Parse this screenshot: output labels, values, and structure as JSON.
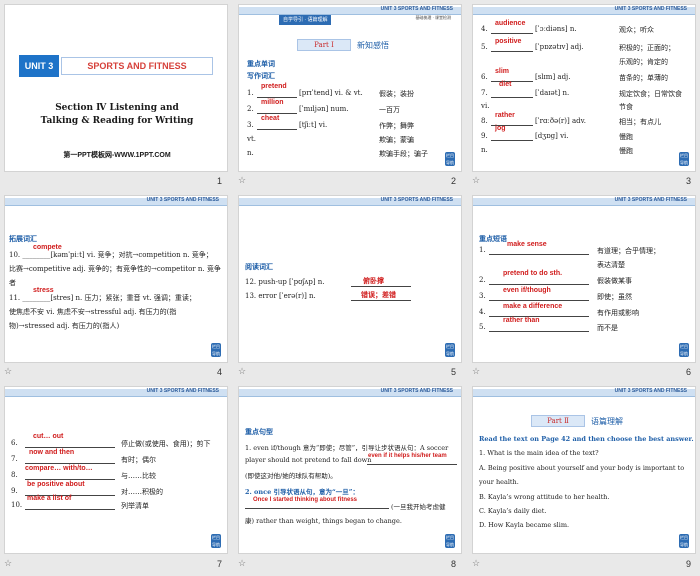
{
  "header": "UNIT 3   SPORTS AND FITNESS",
  "pager_label": "栏目导航",
  "star": "☆",
  "slide1": {
    "unit": "UNIT 3",
    "title": "SPORTS AND FITNESS",
    "section_line1": "Section Ⅳ  Listening and",
    "section_line2": "Talking & Reading for Writing",
    "site": "第一PPT模板网-WWW.1PPT.COM",
    "num": "1"
  },
  "slide2": {
    "tag": "自学导引 · 语篇理解",
    "tag_small": "基础梳理 · 课堂检测",
    "part": "Part Ⅰ",
    "part_title": "新知感悟",
    "h1": "重点单词",
    "h2": "写作词汇",
    "rows": [
      {
        "no": "1.",
        "ans": "pretend",
        "phon": "[prɪˈtend] vi. & vt.",
        "cn": "假装；装扮"
      },
      {
        "no": "2.",
        "ans": "million",
        "phon": "[ˈmɪljən] num.",
        "cn": "一百万"
      },
      {
        "no": "3.",
        "ans": "cheat",
        "phon": "[tʃiːt] vi.",
        "cn": "作弊；舞弊"
      },
      {
        "no": "",
        "ans": "",
        "phon": "vt.",
        "cn": "欺骗；蒙骗"
      },
      {
        "no": "",
        "ans": "",
        "phon": "n.",
        "cn": "欺骗手段；骗子"
      }
    ],
    "num": "2"
  },
  "slide3": {
    "rows": [
      {
        "no": "4.",
        "ans": "audience",
        "phon": "[ˈɔːdiəns] n.",
        "cn": "观众；听众"
      },
      {
        "no": "5.",
        "ans": "positive",
        "phon": "[ˈpɒzətɪv] adj.",
        "cn": "积极的；正面的；"
      },
      {
        "no": "",
        "ans": "",
        "phon": "",
        "cn": "乐观的；肯定的"
      },
      {
        "no": "6.",
        "ans": "slim",
        "phon": "[slɪm] adj.",
        "cn": "苗条的；单薄的"
      },
      {
        "no": "7.",
        "ans": "diet",
        "phon": "[ˈdaɪət] n.",
        "cn": "规定饮食；日常饮食"
      },
      {
        "no": "",
        "ans": "",
        "phon": "vi.",
        "cn": "节食"
      },
      {
        "no": "8.",
        "ans": "rather",
        "phon": "[ˈrɑːðə(r)] adv.",
        "cn": "相当；有点儿"
      },
      {
        "no": "9.",
        "ans": "jog",
        "phon": "[dʒɒg] vi.",
        "cn": "慢跑"
      },
      {
        "no": "",
        "ans": "",
        "phon": "n.",
        "cn": "慢跑"
      }
    ],
    "num": "3"
  },
  "slide4": {
    "h": "拓展词汇",
    "l10_ans": "compete",
    "l10a": "10. ________[kəmˈpiːt] vi. 竞争；对抗→competition n. 竞争；",
    "l10b": "比赛→competitive adj. 竞争的；有竞争性的→competitor n. 竞争",
    "l10c": "者",
    "l11_ans": "stress",
    "l11a": "11. ________[stres] n. 压力；紧张；重音 vt. 强调；重读；",
    "l11b": "使焦虑不安 vi. 焦虑不安→stressful adj. 有压力的(指",
    "l11c": "物)→stressed adj. 有压力的(指人)",
    "num": "4"
  },
  "slide5": {
    "h": "阅读词汇",
    "rows": [
      {
        "en": "12. push-up [ˈpʊʃʌp] n.",
        "ans": "俯卧撑"
      },
      {
        "en": "13. error [ˈerə(r)] n.",
        "ans": "错误；差错"
      }
    ],
    "num": "5"
  },
  "slide6": {
    "h": "重点短语",
    "rows": [
      {
        "no": "1.",
        "ans": "make sense",
        "cn": "有道理；合乎情理；"
      },
      {
        "no": "",
        "ans": "",
        "cn": "表达清楚"
      },
      {
        "no": "2.",
        "ans": "pretend to do sth.",
        "cn": "假装做某事"
      },
      {
        "no": "3.",
        "ans": "even if/though",
        "cn": "即使；虽然"
      },
      {
        "no": "4.",
        "ans": "make a difference",
        "cn": "有作用或影响"
      },
      {
        "no": "5.",
        "ans": "rather than",
        "cn": "而不是"
      }
    ],
    "num": "6"
  },
  "slide7": {
    "rows": [
      {
        "no": "6.",
        "ans": "cut… out",
        "cn": "停止做(或使用、食用)；剪下"
      },
      {
        "no": "7.",
        "ans": "now and then",
        "cn": "有时；偶尔"
      },
      {
        "no": "8.",
        "ans": "compare… with/to…",
        "cn": "与……比较"
      },
      {
        "no": "9.",
        "ans": "be positive about",
        "cn": "对……积极的"
      },
      {
        "no": "10.",
        "ans": "make a list of",
        "cn": "列举清单"
      }
    ],
    "num": "7"
  },
  "slide8": {
    "h": "重点句型",
    "p1a": "1. even if/though 意为“即使；尽管”，引导让步状语从句：A soccer",
    "p1b": "player should not pretend to fall down",
    "p1_ans": "even if it helps his/her team",
    "p1c": "(即使这对他/她的球队有帮助)。",
    "p2a": "2. once 引导状语从句，意为“一旦”：",
    "p2_ans": "Once I started thinking about fitness",
    "p2b": "(一旦我开始考虑健",
    "p2c": "康) rather than weight, things began to change.",
    "num": "8"
  },
  "slide9": {
    "part": "Part Ⅱ",
    "part_title": "语篇理解",
    "instruction": "Read the text on Page 42 and then choose the best answer.",
    "question": "1. What is the main idea of the text?",
    "optA1": "A. Being positive about yourself and your body is important to",
    "optA2": "your health.",
    "optB": "B. Kayla’s wrong attitude to her health.",
    "optC": "C. Kayla’s daily diet.",
    "optD": "D. How Kayla became slim.",
    "num": "9"
  }
}
